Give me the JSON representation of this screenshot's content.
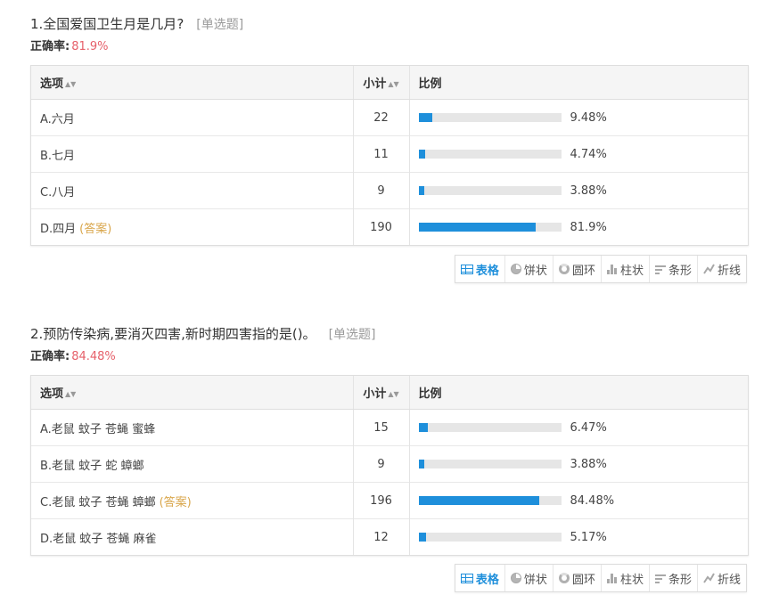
{
  "accuracy_label": "正确率:",
  "table_headers": {
    "option": "选项",
    "count": "小计",
    "ratio": "比例"
  },
  "sort_glyph": "▲▼",
  "toolbar": [
    "表格",
    "饼状",
    "圆环",
    "柱状",
    "条形",
    "折线"
  ],
  "active_tool": "表格",
  "colors": {
    "bar": "#1e8fdb",
    "track": "#e6e6e6",
    "accuracy": "#e6606a",
    "answer_tag": "#d9a64b",
    "active": "#1e8fdb"
  },
  "questions": [
    {
      "title": "1.全国爱国卫生月是几月?",
      "type": "[单选题]",
      "accuracy": "81.9%",
      "rows": [
        {
          "option": "A.六月",
          "answer_tag": "",
          "count": "22",
          "ratio": "9.48%",
          "fraction": 0.0948
        },
        {
          "option": "B.七月",
          "answer_tag": "",
          "count": "11",
          "ratio": "4.74%",
          "fraction": 0.0474
        },
        {
          "option": "C.八月",
          "answer_tag": "",
          "count": "9",
          "ratio": "3.88%",
          "fraction": 0.0388
        },
        {
          "option": "D.四月",
          "answer_tag": "(答案)",
          "count": "190",
          "ratio": "81.9%",
          "fraction": 0.819
        }
      ]
    },
    {
      "title": "2.预防传染病,要消灭四害,新时期四害指的是()。",
      "type": "[单选题]",
      "accuracy": "84.48%",
      "rows": [
        {
          "option": "A.老鼠 蚊子 苍蝇 蜜蜂",
          "answer_tag": "",
          "count": "15",
          "ratio": "6.47%",
          "fraction": 0.0647
        },
        {
          "option": "B.老鼠 蚊子 蛇 蟑螂",
          "answer_tag": "",
          "count": "9",
          "ratio": "3.88%",
          "fraction": 0.0388
        },
        {
          "option": "C.老鼠 蚊子 苍蝇 蟑螂",
          "answer_tag": "(答案)",
          "count": "196",
          "ratio": "84.48%",
          "fraction": 0.8448
        },
        {
          "option": "D.老鼠 蚊子 苍蝇 麻雀",
          "answer_tag": "",
          "count": "12",
          "ratio": "5.17%",
          "fraction": 0.0517
        }
      ]
    }
  ]
}
